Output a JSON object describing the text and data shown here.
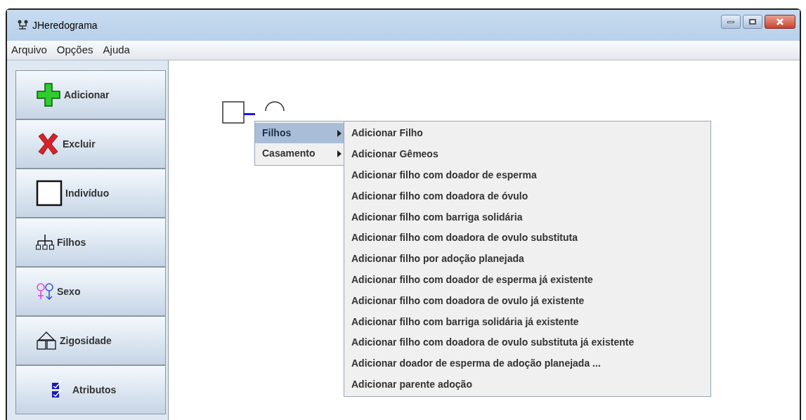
{
  "window": {
    "title": "JHeredograma"
  },
  "menu_bar": [
    "Arquivo",
    "Opções",
    "Ajuda"
  ],
  "toolbar": [
    {
      "kind": "add",
      "label": "Adicionar"
    },
    {
      "kind": "delete",
      "label": "Excluir"
    },
    {
      "kind": "individual",
      "label": "Indivíduo"
    },
    {
      "kind": "children",
      "label": "Filhos"
    },
    {
      "kind": "sex",
      "label": "Sexo"
    },
    {
      "kind": "zygosity",
      "label": "Zigosidade"
    },
    {
      "kind": "attributes",
      "label": "Atributos"
    }
  ],
  "context_menu": [
    {
      "label": "Filhos",
      "selected": true
    },
    {
      "label": "Casamento",
      "selected": false
    }
  ],
  "submenu": [
    "Adicionar Filho",
    "Adicionar Gêmeos",
    "Adicionar filho com doador de esperma",
    "Adicionar filho com doadora de óvulo",
    "Adicionar filho com barriga solidária",
    "Adicionar filho com doadora de ovulo substituta",
    "Adicionar filho por adoção planejada",
    "Adicionar filho com doador de esperma já existente",
    "Adicionar filho com doadora de ovulo já existente",
    "Adicionar filho com barriga solidária já existente",
    "Adicionar filho com doadora de ovulo substituta já existente",
    "Adicionar doador de esperma de adoção planejada ...",
    "Adicionar parente adoção"
  ]
}
